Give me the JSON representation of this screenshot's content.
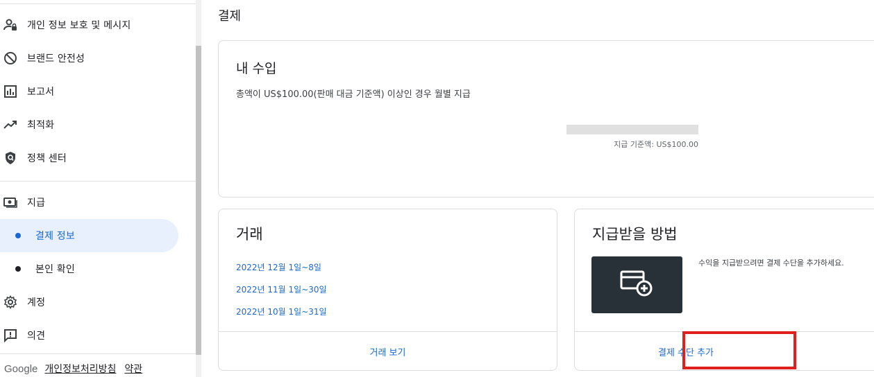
{
  "sidebar": {
    "items": [
      {
        "label": "개인 정보 보호 및 메시지",
        "icon": "person-lock-icon"
      },
      {
        "label": "브랜드 안전성",
        "icon": "block-icon"
      },
      {
        "label": "보고서",
        "icon": "bar-chart-icon"
      },
      {
        "label": "최적화",
        "icon": "trending-up-icon"
      },
      {
        "label": "정책 센터",
        "icon": "policy-shield-icon"
      },
      {
        "label": "지급",
        "icon": "payments-icon"
      },
      {
        "label": "결제 정보",
        "icon": "dot-icon"
      },
      {
        "label": "본인 확인",
        "icon": "dot-icon"
      },
      {
        "label": "계정",
        "icon": "gear-icon"
      },
      {
        "label": "의견",
        "icon": "feedback-icon"
      }
    ],
    "footer": {
      "brand": "Google",
      "privacy": "개인정보처리방침",
      "terms": "약관"
    }
  },
  "main": {
    "title": "결제",
    "earnings": {
      "title": "내 수입",
      "description": "총액이 US$100.00(판매 대금 기준액) 이상인 경우 월별 지급",
      "threshold": "지급 기준액: US$100.00",
      "progress": 0
    },
    "transactions": {
      "title": "거래",
      "periods": [
        "2022년 12월 1일~8일",
        "2022년 11월 1일~30일",
        "2022년 10월 1일~31일"
      ],
      "action": "거래 보기"
    },
    "payment_method": {
      "title": "지급받을 방법",
      "description": "수익을 지급받으려면 결제 수단을 추가하세요.",
      "action": "결제 수단 추가"
    }
  },
  "colors": {
    "accent": "#1967d2",
    "active_bg": "#e8f0fe",
    "highlight": "#e0201f",
    "card_image_bg": "#283137"
  }
}
